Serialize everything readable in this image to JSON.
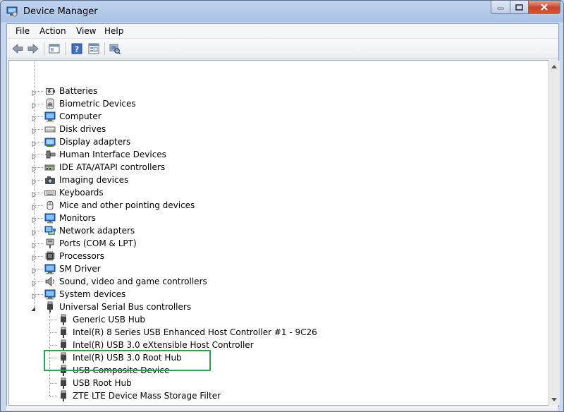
{
  "window": {
    "title": "Device Manager"
  },
  "menu": [
    {
      "label": "File"
    },
    {
      "label": "Action"
    },
    {
      "label": "View"
    },
    {
      "label": "Help"
    }
  ],
  "toolbar": [
    {
      "name": "back-arrow-icon"
    },
    {
      "name": "forward-arrow-icon"
    },
    {
      "name": "show-hide-console-tree-icon"
    },
    {
      "name": "help-icon"
    },
    {
      "name": "properties-icon"
    },
    {
      "name": "scan-hardware-changes-icon"
    }
  ],
  "tree": {
    "categories": [
      {
        "label": "Batteries",
        "icon": "battery-icon"
      },
      {
        "label": "Biometric Devices",
        "icon": "fingerprint-icon"
      },
      {
        "label": "Computer",
        "icon": "computer-icon"
      },
      {
        "label": "Disk drives",
        "icon": "disk-drive-icon"
      },
      {
        "label": "Display adapters",
        "icon": "display-adapter-icon"
      },
      {
        "label": "Human Interface Devices",
        "icon": "hid-icon"
      },
      {
        "label": "IDE ATA/ATAPI controllers",
        "icon": "ide-controller-icon"
      },
      {
        "label": "Imaging devices",
        "icon": "camera-icon"
      },
      {
        "label": "Keyboards",
        "icon": "keyboard-icon"
      },
      {
        "label": "Mice and other pointing devices",
        "icon": "mouse-icon"
      },
      {
        "label": "Monitors",
        "icon": "monitor-icon"
      },
      {
        "label": "Network adapters",
        "icon": "network-adapter-icon"
      },
      {
        "label": "Ports (COM & LPT)",
        "icon": "port-icon"
      },
      {
        "label": "Processors",
        "icon": "processor-icon"
      },
      {
        "label": "SM Driver",
        "icon": "sm-driver-icon"
      },
      {
        "label": "Sound, video and game controllers",
        "icon": "speaker-icon"
      },
      {
        "label": "System devices",
        "icon": "system-devices-icon"
      }
    ],
    "usb": {
      "label": "Universal Serial Bus controllers",
      "icon": "usb-plug-icon",
      "children": [
        {
          "label": "Generic USB Hub"
        },
        {
          "label": "Intel(R) 8 Series USB Enhanced Host Controller #1 - 9C26"
        },
        {
          "label": "Intel(R) USB 3.0 eXtensible Host Controller"
        },
        {
          "label": "Intel(R) USB 3.0 Root Hub"
        },
        {
          "label": "USB Composite Device"
        },
        {
          "label": "USB Root Hub"
        },
        {
          "label": "ZTE LTE Device Mass Storage Filter"
        }
      ]
    }
  },
  "colors": {
    "highlight_box": "#2aa44a",
    "title_gradient": "#a9c3e6",
    "close_button": "#c7432a"
  }
}
